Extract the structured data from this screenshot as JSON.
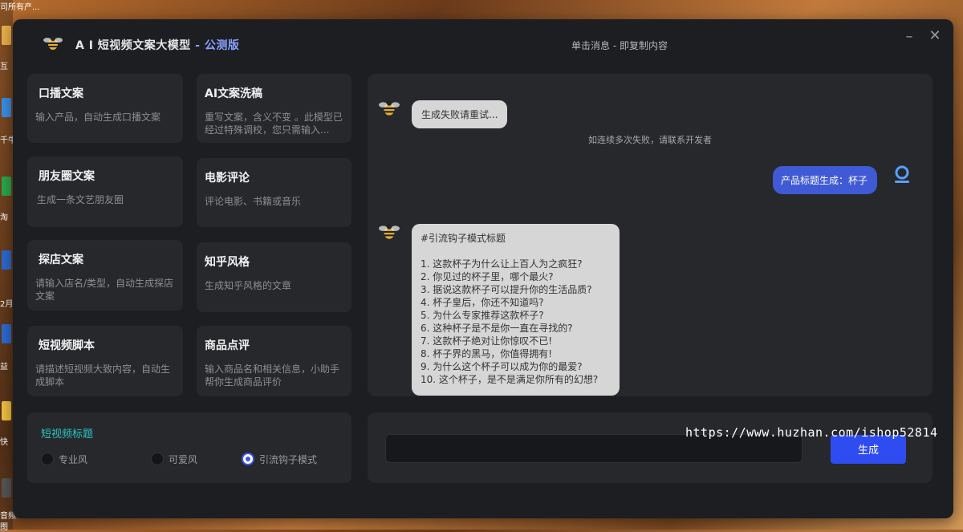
{
  "desktop": {
    "top_text": "司所有产...",
    "side_labels": [
      "互",
      "千牛",
      "淘",
      "2月",
      "益",
      "快",
      "音频",
      "图"
    ]
  },
  "watermark": "https://www.huzhan.com/ishop52814",
  "window": {
    "title": "A I 短视频文案大模型",
    "version": " - 公测版",
    "hint": "单击消息 - 即复制内容",
    "minimize": "–",
    "close": "✕"
  },
  "cards": [
    {
      "title": "口播文案",
      "desc": "输入产品，自动生成口播文案"
    },
    {
      "title": "AI文案洗稿",
      "desc": "重写文案，含义不变 。此模型已经过特殊调校，您只需输入..."
    },
    {
      "title": "朋友圈文案",
      "desc": "生成一条文艺朋友圈"
    },
    {
      "title": "电影评论",
      "desc": "评论电影、书籍或音乐"
    },
    {
      "title": "探店文案",
      "desc": "请输入店名/类型，自动生成探店文案"
    },
    {
      "title": "知乎风格",
      "desc": "生成知乎风格的文章"
    },
    {
      "title": "短视频脚本",
      "desc": "请描述短视频大致内容，自动生成脚本"
    },
    {
      "title": "商品点评",
      "desc": "输入商品名和相关信息，小助手帮你生成商品评价"
    }
  ],
  "options": {
    "title": "短视频标题",
    "choices": [
      "专业风",
      "可爱风",
      "引流钩子模式"
    ],
    "selected": "引流钩子模式"
  },
  "chat": {
    "bot_msg_1": "生成失败请重试...",
    "system_note": "如连续多次失败，请联系开发者",
    "user_msg": "产品标题生成：杯子",
    "bot_msg_2_lines": [
      "#引流钩子模式标题",
      "",
      "1. 这款杯子为什么让上百人为之疯狂?",
      "2. 你见过的杯子里，哪个最火?",
      "3. 据说这款杯子可以提升你的生活品质?",
      "4. 杯子皇后，你还不知道吗?",
      "5. 为什么专家推荐这款杯子?",
      "6. 这种杯子是不是你一直在寻找的?",
      "7. 这款杯子绝对让你惊叹不已!",
      "8. 杯子界的黑马，你值得拥有!",
      "9. 为什么这个杯子可以成为你的最爱?",
      "10. 这个杯子，是不是满足你所有的幻想?"
    ]
  },
  "input": {
    "value": "",
    "button": "生成"
  },
  "colors": {
    "accent": "#2f4cf0",
    "user_bubble": "#3f5ad4",
    "option_title": "#2ec6c0",
    "window_bg": "#1c1e22",
    "card_bg": "#26282c"
  }
}
